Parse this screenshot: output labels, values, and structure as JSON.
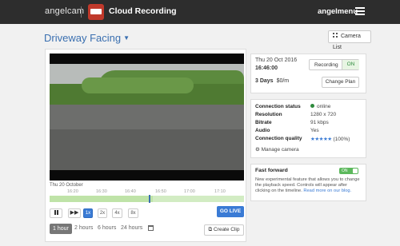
{
  "header": {
    "logo": "angelcam",
    "product_title": "Cloud Recording",
    "user_menu": "angelmenu"
  },
  "camera": {
    "title": "Driveway Facing",
    "camera_list_label": "Camera List"
  },
  "timeline": {
    "date_label": "Thu 20 October",
    "ticks": [
      "16:20",
      "16:30",
      "16:40",
      "16:50",
      "17:00",
      "17:10"
    ],
    "recorded_fraction": 0.53,
    "cursor_fraction": 0.51
  },
  "controls": {
    "speeds": [
      "1x",
      "2x",
      "4x",
      "8x"
    ],
    "active_speed": "1x",
    "go_live_label": "GO LIVE",
    "ranges": [
      "1 hour",
      "2 hours",
      "6 hours",
      "24 hours"
    ],
    "active_range": "1 hour",
    "create_clip_label": "Create Clip"
  },
  "info": {
    "date": "Thu 20 Oct 2016",
    "time": "16:46:00",
    "recording_label": "Recording",
    "recording_state": "ON",
    "plan_days": "3 Days",
    "plan_price": "$0/m",
    "change_plan_label": "Change Plan"
  },
  "status": {
    "rows": [
      {
        "key": "Connection status",
        "value": "online"
      },
      {
        "key": "Resolution",
        "value": "1280 x 720"
      },
      {
        "key": "Bitrate",
        "value": "91 kbps"
      },
      {
        "key": "Audio",
        "value": "Yes"
      },
      {
        "key": "Connection quality",
        "value": "(100%)"
      }
    ],
    "quality_stars": 5,
    "manage_label": "Manage camera"
  },
  "fast_forward": {
    "title": "Fast forward",
    "toggle_label": "ON",
    "description": "New experimental feature that allows you to change the playback speed. Controls will appear after clicking on the timeline.",
    "link_text": "Read more on our blog."
  },
  "colors": {
    "accent": "#3a7bd5",
    "online": "#2e8b3d",
    "topbar": "#2d2d2d"
  }
}
